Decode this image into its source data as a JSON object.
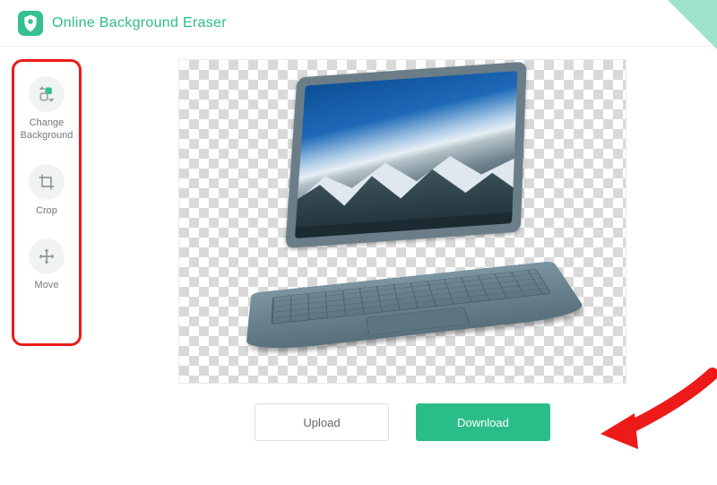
{
  "header": {
    "title": "Online Background Eraser"
  },
  "sidebar": {
    "tools": [
      {
        "id": "change-bg",
        "label": "Change\nBackground"
      },
      {
        "id": "crop",
        "label": "Crop"
      },
      {
        "id": "move",
        "label": "Move"
      }
    ]
  },
  "actions": {
    "upload": "Upload",
    "download": "Download"
  },
  "colors": {
    "accent": "#2bbd88",
    "annotation": "#ed1a1a"
  }
}
